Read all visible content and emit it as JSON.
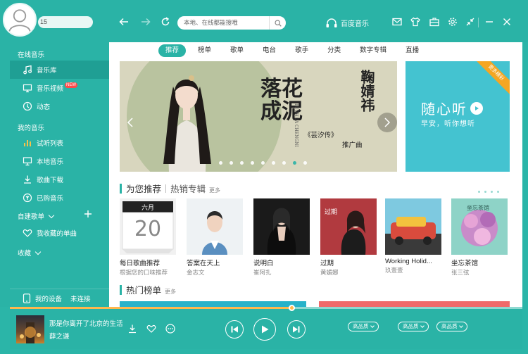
{
  "user": {
    "name_prefix": "15"
  },
  "search": {
    "placeholder": "本地、在线都能搜哦"
  },
  "brand": {
    "label": "百度音乐"
  },
  "sidebar": {
    "online_title": "在线音乐",
    "items_online": [
      {
        "label": "音乐库",
        "icon": "music-note-icon",
        "active": true
      },
      {
        "label": "音乐视频",
        "icon": "tv-icon",
        "badge": "NEW"
      },
      {
        "label": "动态",
        "icon": "compass-icon"
      }
    ],
    "mine_title": "我的音乐",
    "items_mine": [
      {
        "label": "试听列表",
        "icon": "bars-icon"
      },
      {
        "label": "本地音乐",
        "icon": "monitor-icon"
      },
      {
        "label": "歌曲下载",
        "icon": "download-icon"
      },
      {
        "label": "已购音乐",
        "icon": "purchased-icon"
      }
    ],
    "playlist_title": "自建歌单",
    "favorites": "我收藏的单曲",
    "collect_title": "收藏",
    "device": {
      "label": "我的设备",
      "status": "未连接"
    }
  },
  "tabs": [
    "推荐",
    "榜单",
    "歌单",
    "电台",
    "歌手",
    "分类",
    "数字专辑",
    "直播"
  ],
  "banner": {
    "title": "落花成泥",
    "artist": "鞠婧祎",
    "subtitle1": "《芸汐传》",
    "subtitle2": "推广曲",
    "pinyin": "LUOHUA CHENGNI"
  },
  "side_banner": {
    "big": "随心听",
    "small": "早安，听你想听",
    "ribbon": "更多精彩"
  },
  "recommend": {
    "title": "为您推荐",
    "title2": "热销专辑",
    "more": "更多",
    "albums": [
      {
        "title": "每日歌曲推荐",
        "subtitle": "根据您的口味推荐",
        "cover_month": "六月",
        "cover_day": "20"
      },
      {
        "title": "答案在天上",
        "subtitle": "金志文"
      },
      {
        "title": "说明白",
        "subtitle": "崔阿扎"
      },
      {
        "title": "过期",
        "subtitle": "黄媚娜"
      },
      {
        "title": "Working Holid...",
        "subtitle": "玖壹壹"
      },
      {
        "title": "坐忘茶馆",
        "subtitle": "张三弦"
      }
    ]
  },
  "hot_charts": {
    "title": "热门榜单",
    "more": "更多"
  },
  "player": {
    "title": "那是你离开了北京的生活",
    "artist": "薛之谦",
    "quality_labels": [
      "高品质",
      "高品质",
      "高品质"
    ],
    "progress": 0.55
  },
  "colors": {
    "accent": "#2ab3a6",
    "accent_dark": "#1f9f94",
    "progress": "#ffb84d"
  }
}
